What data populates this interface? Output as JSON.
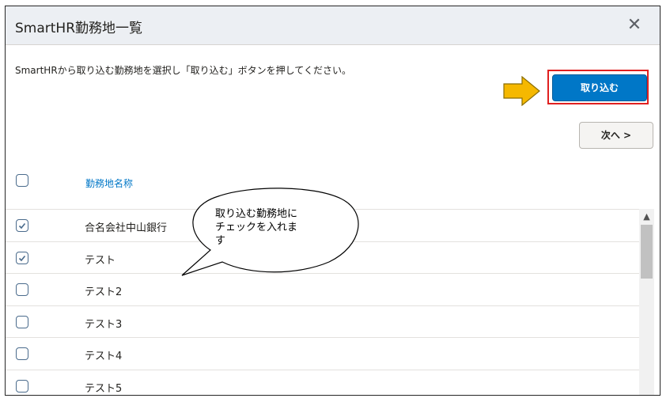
{
  "dialog": {
    "title": "SmartHR勤務地一覧",
    "close_glyph": "✕",
    "description": "SmartHRから取り込む勤務地を選択し「取り込む」ボタンを押してください。",
    "import_label": "取り込む",
    "next_label": "次へ >",
    "column_header": "勤務地名称",
    "select_all_checked": false
  },
  "rows": [
    {
      "label": "合名会社中山銀行",
      "checked": true
    },
    {
      "label": "テスト",
      "checked": true
    },
    {
      "label": "テスト2",
      "checked": false
    },
    {
      "label": "テスト3",
      "checked": false
    },
    {
      "label": "テスト4",
      "checked": false
    },
    {
      "label": "テスト5",
      "checked": false
    }
  ],
  "annotation": {
    "callout_text": "取り込む勤務地に\nチェックを入れま\nす"
  },
  "colors": {
    "primary": "#0077c7",
    "highlight": "#e02020",
    "arrow": "#f5b800"
  },
  "icons": {
    "close": "close-icon",
    "check": "check-icon",
    "arrow": "right-arrow-icon",
    "scroll_up": "chevron-up-icon"
  }
}
